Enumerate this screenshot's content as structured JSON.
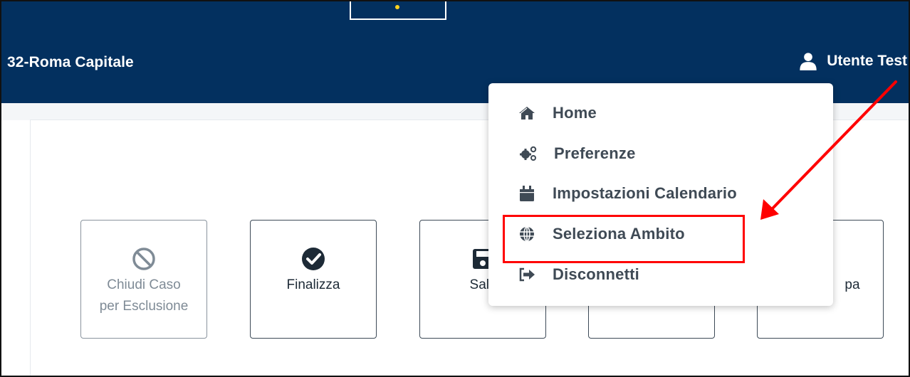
{
  "header": {
    "org_title": "32-Roma Capitale",
    "user_name": "Utente Test",
    "bg_color": "#03305f"
  },
  "actions": [
    {
      "label_line1": "Chiudi Caso",
      "label_line2": "per Esclusione",
      "icon": "ban-icon",
      "disabled": true
    },
    {
      "label_line1": "Finalizza",
      "label_line2": "",
      "icon": "check-circle-icon",
      "disabled": false
    },
    {
      "label_line1": "Salv",
      "label_line2": "",
      "icon": "save-icon",
      "disabled": false
    },
    {
      "label_line1": "",
      "label_line2": "",
      "icon": "",
      "disabled": false
    },
    {
      "label_line1": "pa",
      "label_line2": "",
      "icon": "print-icon",
      "disabled": false
    }
  ],
  "user_menu": {
    "items": [
      {
        "label": "Home",
        "icon": "home-icon"
      },
      {
        "label": "Preferenze",
        "icon": "gears-icon"
      },
      {
        "label": "Impostazioni Calendario",
        "icon": "calendar-icon"
      },
      {
        "label": "Seleziona Ambito",
        "icon": "globe-icon",
        "highlighted": true
      },
      {
        "label": "Disconnetti",
        "icon": "sign-out-icon"
      }
    ]
  },
  "annotation": {
    "color": "#ff0000",
    "target": "Seleziona Ambito"
  }
}
